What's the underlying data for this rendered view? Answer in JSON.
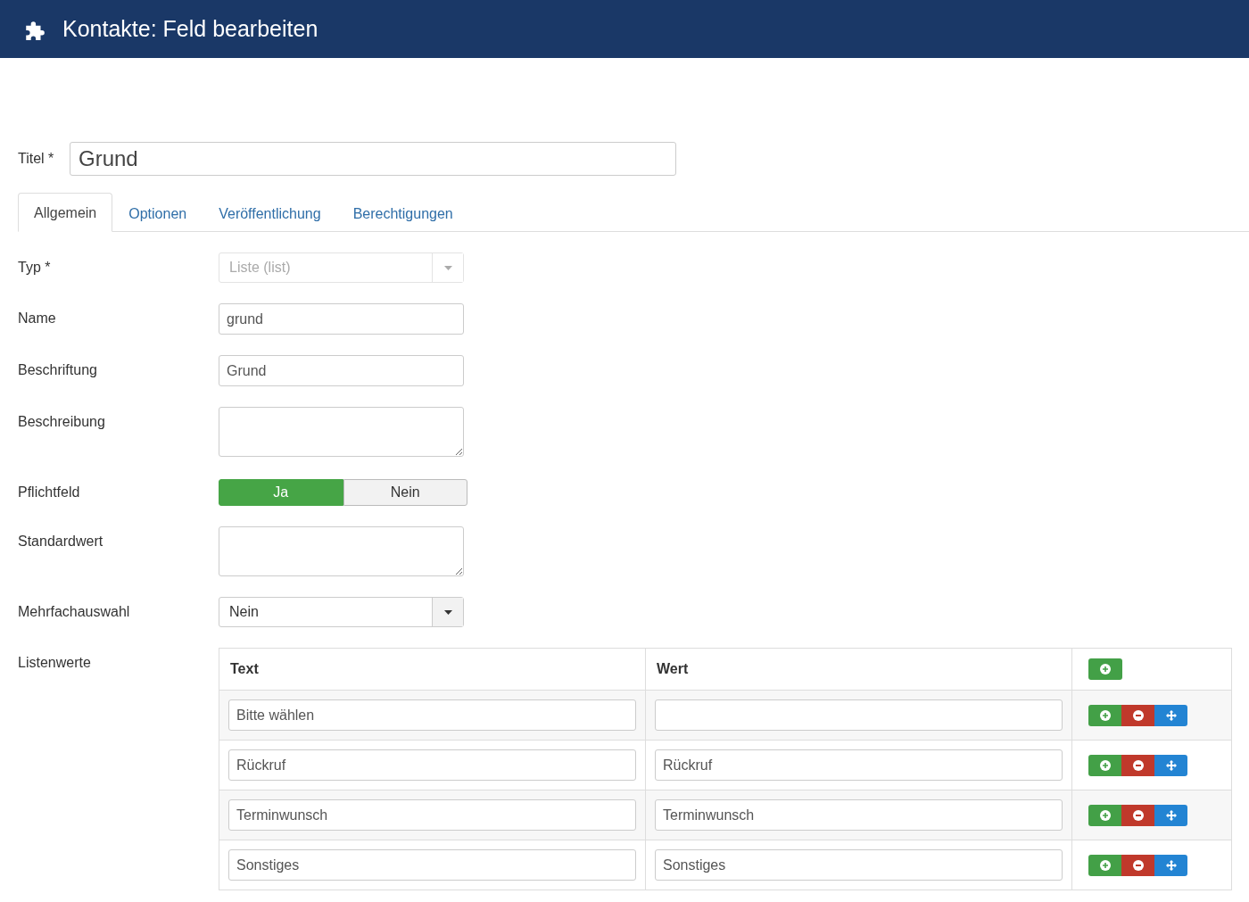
{
  "header": {
    "title": "Kontakte: Feld bearbeiten"
  },
  "title_field": {
    "label": "Titel *",
    "value": "Grund"
  },
  "tabs": [
    {
      "label": "Allgemein",
      "selected": true
    },
    {
      "label": "Optionen",
      "selected": false
    },
    {
      "label": "Veröffentlichung",
      "selected": false
    },
    {
      "label": "Berechtigungen",
      "selected": false
    }
  ],
  "fields": [
    {
      "kind": "select",
      "label": "Typ *",
      "value": "Liste (list)",
      "disabled": true
    },
    {
      "kind": "text",
      "label": "Name",
      "value": "grund"
    },
    {
      "kind": "text",
      "label": "Beschriftung",
      "value": "Grund"
    },
    {
      "kind": "textarea",
      "label": "Beschreibung"
    },
    {
      "kind": "toggle",
      "label": "Pflichtfeld",
      "options": [
        {
          "label": "Ja",
          "selected": true
        },
        {
          "label": "Nein",
          "selected": false
        }
      ]
    },
    {
      "kind": "textarea",
      "label": "Standardwert"
    },
    {
      "kind": "select",
      "label": "Mehrfachauswahl",
      "value": "Nein",
      "disabled": false
    },
    {
      "kind": "list",
      "label": "Listenwerte"
    }
  ],
  "list_values": {
    "columns": [
      "Text",
      "Wert"
    ],
    "rows": [
      {
        "text": "Bitte wählen",
        "value": ""
      },
      {
        "text": "Rückruf",
        "value": "Rückruf"
      },
      {
        "text": "Terminwunsch",
        "value": "Terminwunsch"
      },
      {
        "text": "Sonstiges",
        "value": "Sonstiges"
      }
    ]
  }
}
